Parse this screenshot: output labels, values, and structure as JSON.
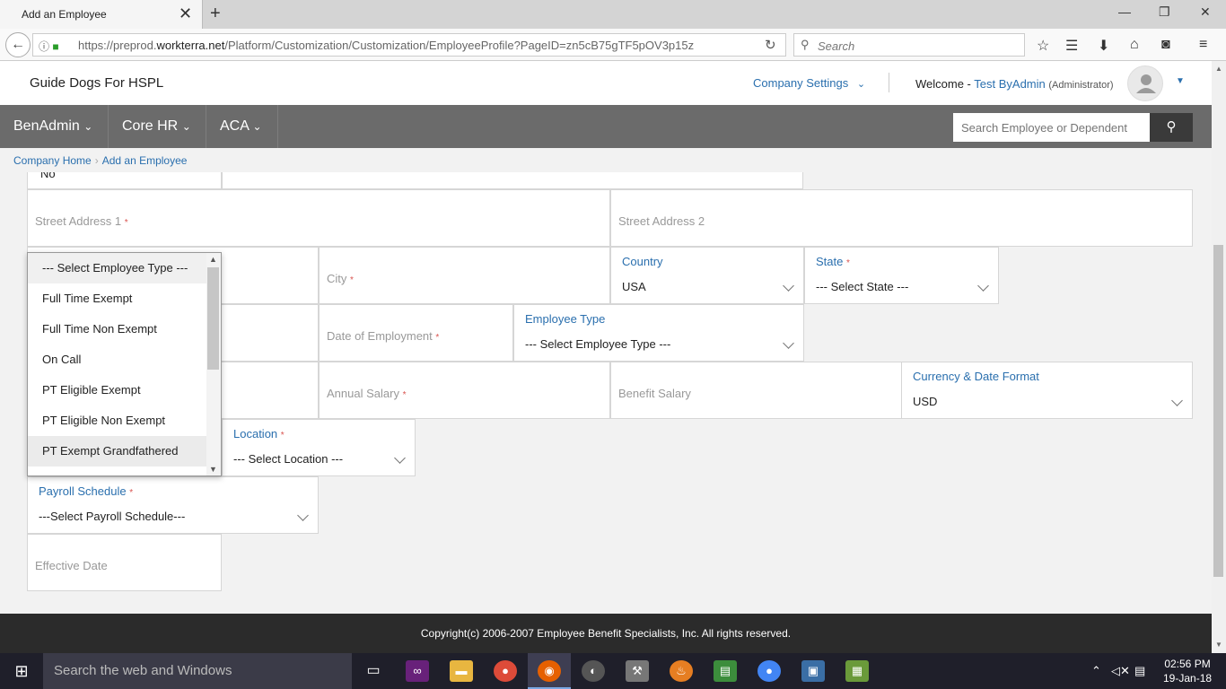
{
  "browser": {
    "tab_title": "Add an Employee",
    "url_prefix": "https://preprod.",
    "url_domain": "workterra.net",
    "url_path": "/Platform/Customization/Customization/EmployeeProfile?PageID=zn5cB75gTF5pOV3p15z",
    "search_placeholder": "Search"
  },
  "header": {
    "company_name": "Guide Dogs For HSPL",
    "company_settings": "Company Settings",
    "welcome": "Welcome -",
    "user_name": "Test ByAdmin",
    "role": "(Administrator)"
  },
  "nav": {
    "items": [
      {
        "label": "BenAdmin"
      },
      {
        "label": "Core HR"
      },
      {
        "label": "ACA"
      }
    ],
    "search_placeholder": "Search Employee or Dependent"
  },
  "breadcrumb": [
    "Company Home",
    "Add an Employee"
  ],
  "form": {
    "partial_value": "No",
    "street1": "Street Address 1",
    "street2": "Street Address 2",
    "city": "City",
    "country_label": "Country",
    "country_value": "USA",
    "state_label": "State",
    "state_value": "--- Select State ---",
    "date_of_employment": "Date of Employment",
    "employee_type_label": "Employee Type",
    "employee_type_value": "--- Select Employee Type ---",
    "annual_salary": "Annual Salary",
    "benefit_salary": "Benefit Salary",
    "currency_label": "Currency & Date Format",
    "currency_value": "USD",
    "location_label": "Location",
    "location_value": "--- Select Location ---",
    "payroll_label": "Payroll Schedule",
    "payroll_value": "---Select Payroll Schedule---",
    "effective_date": "Effective Date",
    "required_mark": "*"
  },
  "dropdown": {
    "options": [
      "--- Select Employee Type ---",
      "Full Time Exempt",
      "Full Time Non Exempt",
      "On Call",
      "PT Eligible Exempt",
      "PT Eligible Non Exempt",
      "PT Exempt Grandfathered"
    ]
  },
  "footer": {
    "text": "Copyright(c) 2006-2007 Employee Benefit Specialists, Inc. All rights reserved."
  },
  "taskbar": {
    "search_placeholder": "Search the web and Windows",
    "time": "02:56 PM",
    "date": "19-Jan-18"
  },
  "colors": {
    "accent": "#2a6fae",
    "nav_bg": "#6b6b6b",
    "required": "#d9534f"
  }
}
